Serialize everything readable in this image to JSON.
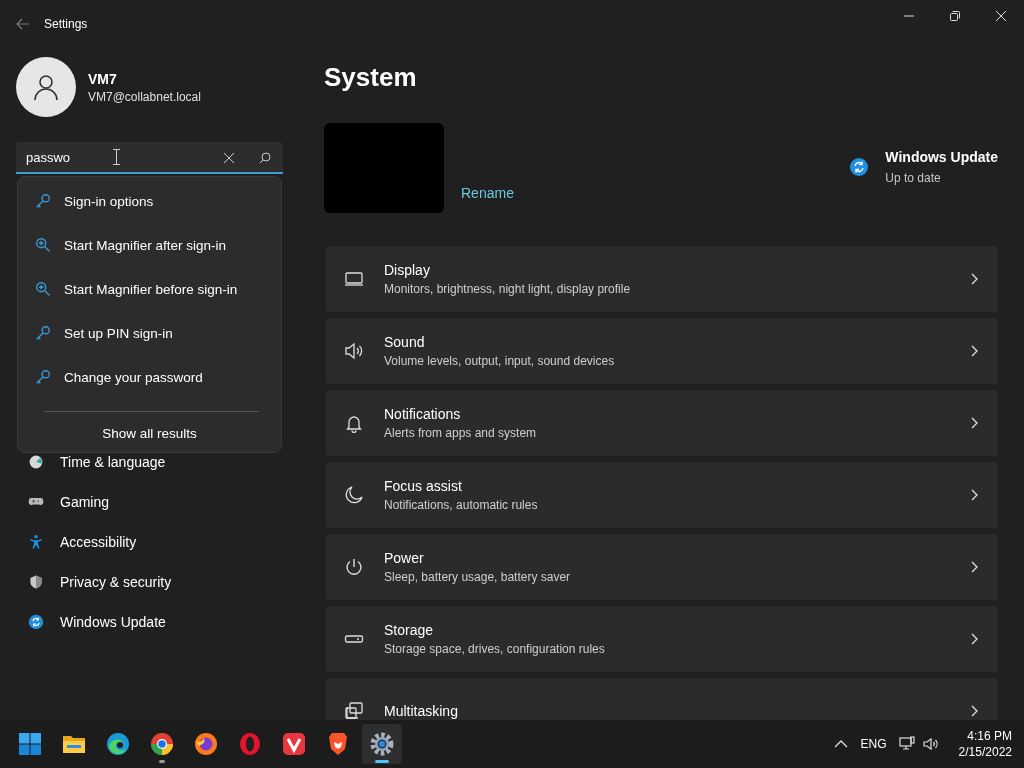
{
  "window": {
    "title": "Settings"
  },
  "user": {
    "name": "VM7",
    "email": "VM7@collabnet.local"
  },
  "search": {
    "value": "passwo"
  },
  "search_results": [
    {
      "label": "Sign-in options",
      "kind": "key"
    },
    {
      "label": "Start Magnifier after sign-in",
      "kind": "magnifier"
    },
    {
      "label": "Start Magnifier before sign-in",
      "kind": "magnifier"
    },
    {
      "label": "Set up PIN sign-in",
      "kind": "key"
    },
    {
      "label": "Change your password",
      "kind": "key"
    }
  ],
  "show_all": "Show all results",
  "nav": [
    {
      "label": "Time & language",
      "kind": "clock"
    },
    {
      "label": "Gaming",
      "kind": "gamepad"
    },
    {
      "label": "Accessibility",
      "kind": "person"
    },
    {
      "label": "Privacy & security",
      "kind": "shield"
    },
    {
      "label": "Windows Update",
      "kind": "update"
    }
  ],
  "page": {
    "title": "System",
    "rename": "Rename",
    "update": {
      "title": "Windows Update",
      "status": "Up to date"
    }
  },
  "cards": [
    {
      "title": "Display",
      "subtitle": "Monitors, brightness, night light, display profile",
      "kind": "display"
    },
    {
      "title": "Sound",
      "subtitle": "Volume levels, output, input, sound devices",
      "kind": "sound"
    },
    {
      "title": "Notifications",
      "subtitle": "Alerts from apps and system",
      "kind": "bell"
    },
    {
      "title": "Focus assist",
      "subtitle": "Notifications, automatic rules",
      "kind": "moon"
    },
    {
      "title": "Power",
      "subtitle": "Sleep, battery usage, battery saver",
      "kind": "power"
    },
    {
      "title": "Storage",
      "subtitle": "Storage space, drives, configuration rules",
      "kind": "storage"
    },
    {
      "title": "Multitasking",
      "kind": "multitask"
    }
  ],
  "taskbar": {
    "apps": [
      {
        "kind": "start",
        "running": false,
        "active": false
      },
      {
        "kind": "folder",
        "running": false,
        "active": false
      },
      {
        "kind": "edge",
        "running": false,
        "active": false
      },
      {
        "kind": "chrome",
        "running": true,
        "active": false
      },
      {
        "kind": "firefox",
        "running": false,
        "active": false
      },
      {
        "kind": "opera",
        "running": false,
        "active": false
      },
      {
        "kind": "vivaldi",
        "running": false,
        "active": false
      },
      {
        "kind": "brave",
        "running": false,
        "active": false
      },
      {
        "kind": "settings",
        "running": false,
        "active": true
      }
    ],
    "language": "ENG",
    "time": "4:16 PM",
    "date": "2/15/2022"
  }
}
